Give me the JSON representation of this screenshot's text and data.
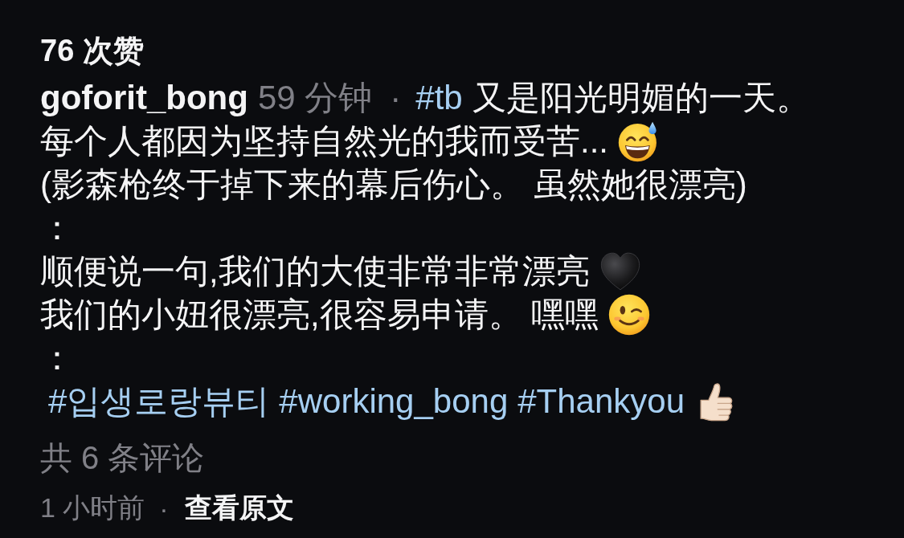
{
  "likes": "76 次赞",
  "caption": {
    "lines": [
      [
        {
          "kind": "username",
          "text": "goforit_bong"
        },
        {
          "kind": "time",
          "text": "59 分钟"
        },
        {
          "kind": "separator",
          "text": "·"
        },
        {
          "kind": "hashtag",
          "text": "#tb"
        },
        {
          "kind": "text",
          "text": "又是阳光明媚的一天。"
        }
      ],
      [
        {
          "kind": "text",
          "text": "每个人都因为坚持自然光的我而受苦..."
        },
        {
          "kind": "sweatsmile"
        }
      ],
      [
        {
          "kind": "text",
          "text": "(影森枪终于掉下来的幕后伤心。 虽然她很漂亮)"
        }
      ],
      [
        {
          "kind": "text",
          "text": "："
        }
      ],
      [
        {
          "kind": "text",
          "text": "顺便说一句,我们的大使非常非常漂亮"
        },
        {
          "kind": "heart"
        }
      ],
      [
        {
          "kind": "text",
          "text": "我们的小妞很漂亮,很容易申请。 嘿嘿"
        },
        {
          "kind": "wink"
        }
      ],
      [
        {
          "kind": "text",
          "text": "："
        }
      ],
      [
        {
          "kind": "hashtag",
          "text": "#입생로랑뷰티"
        },
        {
          "kind": "hashtag",
          "text": "#working_bong"
        },
        {
          "kind": "hashtag",
          "text": "#Thankyou"
        },
        {
          "kind": "thumbsup"
        }
      ]
    ]
  },
  "comments": "共 6 条评论",
  "footer": {
    "time": "1 小时前",
    "separator": "·",
    "link": "查看原文"
  }
}
